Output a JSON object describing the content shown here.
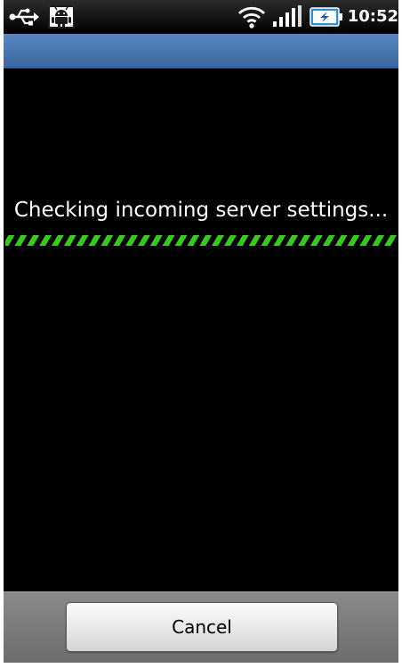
{
  "status_bar": {
    "time": "10:52",
    "left_icons": [
      "usb-icon",
      "android-debug-icon"
    ],
    "right_icons": [
      "wifi-icon",
      "signal-icon",
      "battery-charging-icon"
    ]
  },
  "dialog": {
    "message": "Checking incoming server settings...",
    "progress": "indeterminate"
  },
  "bottom_bar": {
    "cancel_label": "Cancel"
  },
  "colors": {
    "title_bar": "#4a77b3",
    "progress": "#37c91e",
    "background": "#000000",
    "bottom_bar": "#7a7a7a"
  }
}
